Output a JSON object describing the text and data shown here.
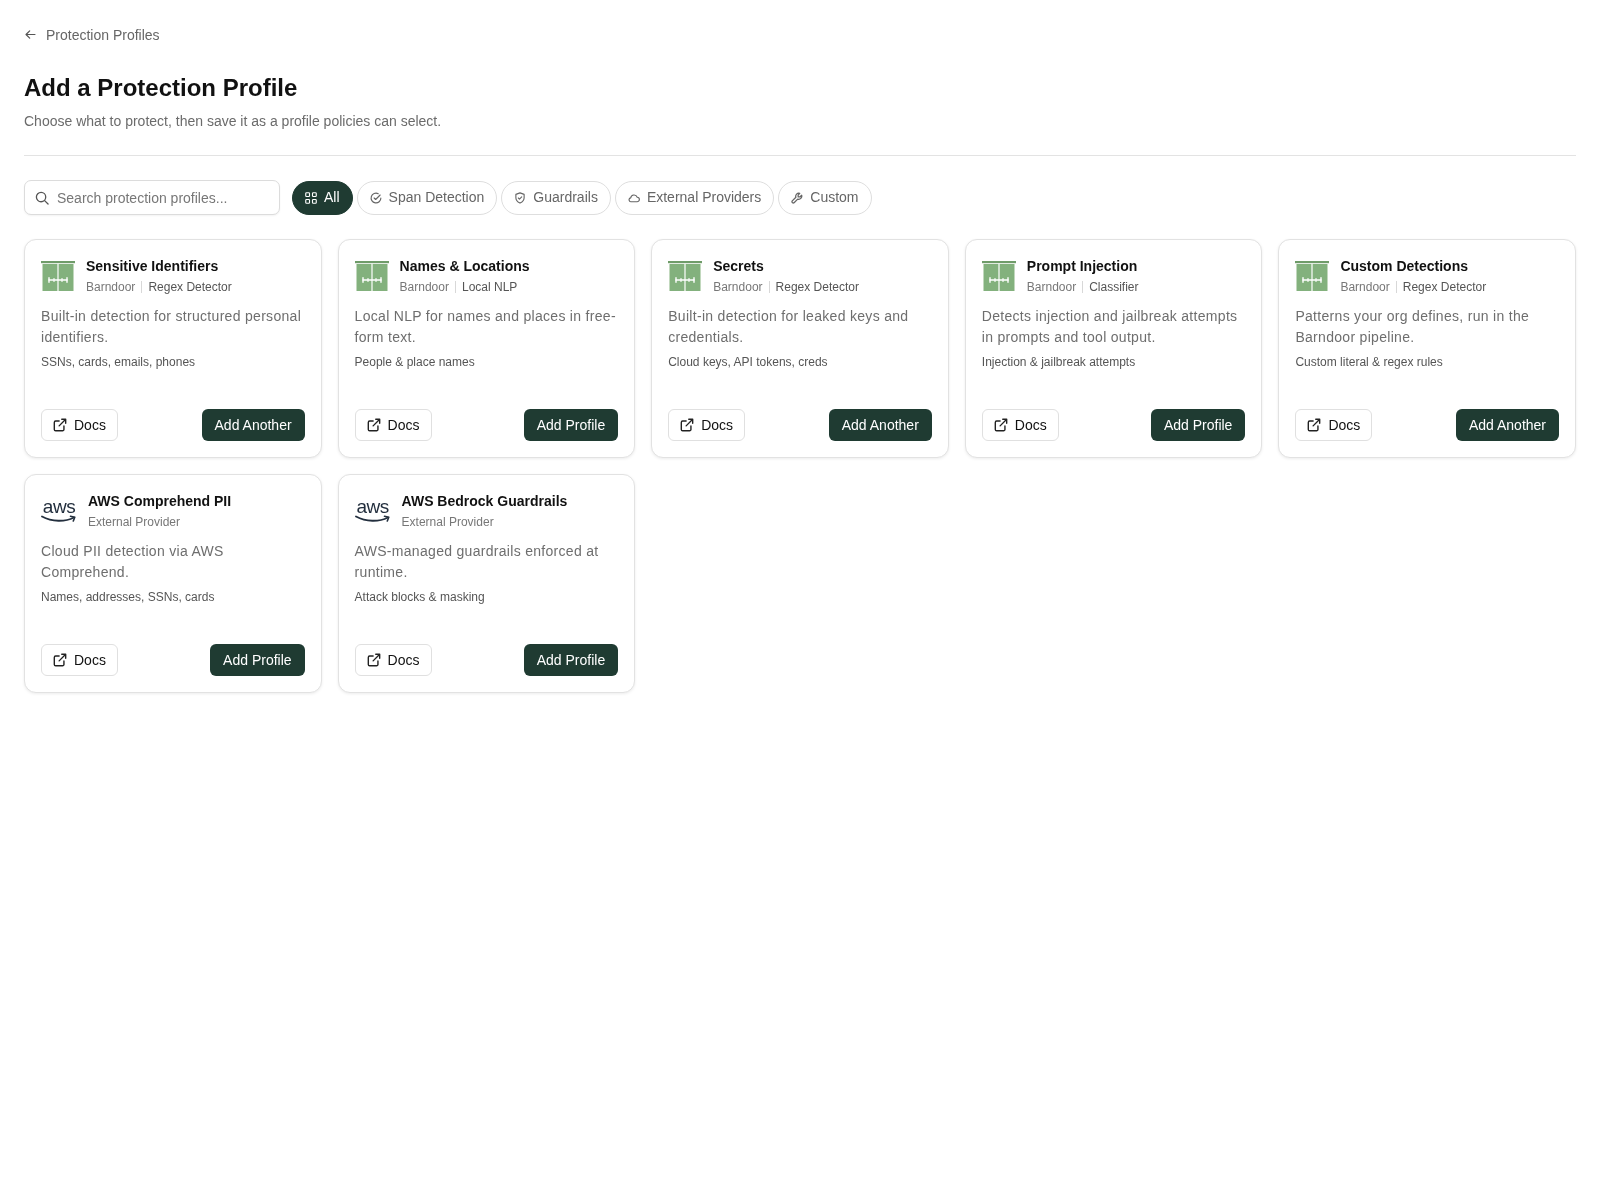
{
  "back_link": {
    "label": "Protection Profiles"
  },
  "header": {
    "title": "Add a Protection Profile",
    "subtitle": "Choose what to protect, then save it as a profile policies can select."
  },
  "search": {
    "placeholder": "Search protection profiles..."
  },
  "filters": [
    {
      "kind": "all",
      "label": "All",
      "selected": true
    },
    {
      "kind": "span",
      "label": "Span Detection",
      "selected": false
    },
    {
      "kind": "guardrails",
      "label": "Guardrails",
      "selected": false
    },
    {
      "kind": "external",
      "label": "External Providers",
      "selected": false
    },
    {
      "kind": "custom",
      "label": "Custom",
      "selected": false
    }
  ],
  "cards": [
    {
      "name": "Sensitive Identifiers",
      "logo": {
        "kind": "barndoor"
      },
      "meta": [
        "Barndoor",
        "Regex Detector"
      ],
      "description": "Built-in detection for structured personal identifiers.",
      "tags": "SSNs, cards, emails, phones",
      "docs_label": "Docs",
      "action_label": "Add Another"
    },
    {
      "name": "Names & Locations",
      "logo": {
        "kind": "barndoor"
      },
      "meta": [
        "Barndoor",
        "Local NLP"
      ],
      "description": "Local NLP for names and places in free-form text.",
      "tags": "People & place names",
      "docs_label": "Docs",
      "action_label": "Add Profile"
    },
    {
      "name": "Secrets",
      "logo": {
        "kind": "barndoor"
      },
      "meta": [
        "Barndoor",
        "Regex Detector"
      ],
      "description": "Built-in detection for leaked keys and credentials.",
      "tags": "Cloud keys, API tokens, creds",
      "docs_label": "Docs",
      "action_label": "Add Another"
    },
    {
      "name": "Prompt Injection",
      "logo": {
        "kind": "barndoor"
      },
      "meta": [
        "Barndoor",
        "Classifier"
      ],
      "description": "Detects injection and jailbreak attempts in prompts and tool output.",
      "tags": "Injection & jailbreak attempts",
      "docs_label": "Docs",
      "action_label": "Add Profile"
    },
    {
      "name": "Custom Detections",
      "logo": {
        "kind": "barndoor"
      },
      "meta": [
        "Barndoor",
        "Regex Detector"
      ],
      "description": "Patterns your org defines, run in the Barndoor pipeline.",
      "tags": "Custom literal & regex rules",
      "docs_label": "Docs",
      "action_label": "Add Another"
    },
    {
      "name": "AWS Comprehend PII",
      "logo": {
        "kind": "aws",
        "text": "aws"
      },
      "meta": [
        "External Provider"
      ],
      "description": "Cloud PII detection via AWS Comprehend.",
      "tags": "Names, addresses, SSNs, cards",
      "docs_label": "Docs",
      "action_label": "Add Profile"
    },
    {
      "name": "AWS Bedrock Guardrails",
      "logo": {
        "kind": "aws",
        "text": "aws"
      },
      "meta": [
        "External Provider"
      ],
      "description": "AWS-managed guardrails enforced at runtime.",
      "tags": "Attack blocks & masking",
      "docs_label": "Docs",
      "action_label": "Add Profile"
    }
  ]
}
